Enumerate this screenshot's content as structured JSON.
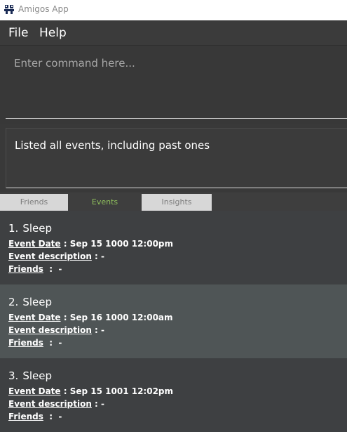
{
  "window": {
    "title": "Amigos App"
  },
  "menu": {
    "file": "File",
    "help": "Help"
  },
  "command": {
    "placeholder": "Enter command here...",
    "value": ""
  },
  "result": {
    "text": "Listed all events, including past ones"
  },
  "tabs": [
    {
      "label": "Friends",
      "active": false
    },
    {
      "label": "Events",
      "active": true
    },
    {
      "label": "Insights",
      "active": false
    }
  ],
  "colors": {
    "active_tab_text": "#8fbf5c",
    "highlight_row": "#4f5556",
    "background": "#3e4042"
  },
  "events": [
    {
      "index": "1.",
      "name": "Sleep",
      "date_label": "Event Date",
      "date_value": " : Sep 15 1000 12:00pm",
      "desc_label": "Event description",
      "desc_value": " : -",
      "friends_label": "Friends",
      "friends_value": "  :  -"
    },
    {
      "index": "2.",
      "name": "Sleep",
      "date_label": "Event Date",
      "date_value": " : Sep 16 1000 12:00am",
      "desc_label": "Event description",
      "desc_value": " : -",
      "friends_label": "Friends",
      "friends_value": "  :  -"
    },
    {
      "index": "3.",
      "name": "Sleep",
      "date_label": "Event Date",
      "date_value": " : Sep 15 1001 12:02pm",
      "desc_label": "Event description",
      "desc_value": " : -",
      "friends_label": "Friends",
      "friends_value": "  :  -"
    }
  ]
}
